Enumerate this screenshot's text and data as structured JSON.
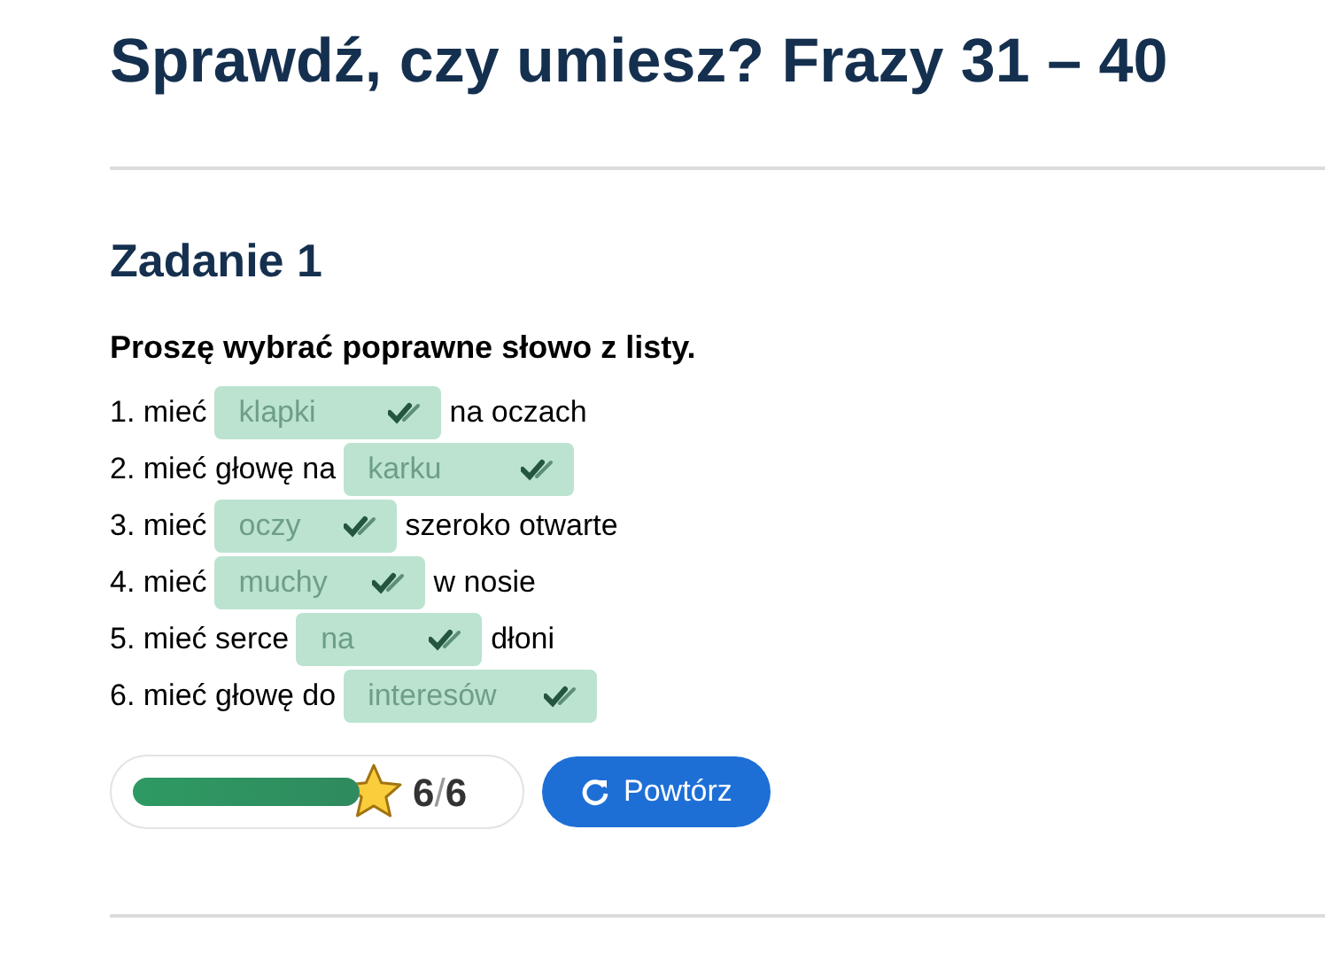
{
  "title": "Sprawdź, czy umiesz? Frazy 31 – 40",
  "task": {
    "heading": "Zadanie 1",
    "instruction": "Proszę wybrać poprawne słowo z listy.",
    "items": [
      {
        "before": "1. mieć",
        "answer": "klapki",
        "after": "na oczach",
        "correct": true
      },
      {
        "before": "2. mieć głowę na",
        "answer": "karku",
        "correct": true
      },
      {
        "before": "3. mieć",
        "answer": "oczy",
        "after": "szeroko otwarte",
        "correct": true
      },
      {
        "before": "4. mieć",
        "answer": "muchy",
        "after": "w nosie",
        "correct": true
      },
      {
        "before": "5. mieć serce",
        "answer": "na",
        "after": "dłoni",
        "correct": true
      },
      {
        "before": "6. mieć głowę do",
        "answer": "interesów",
        "correct": true
      }
    ]
  },
  "score": {
    "level": 1,
    "points": "6",
    "separator": "/",
    "total": "6"
  },
  "repeat_button": "Powtórz"
}
